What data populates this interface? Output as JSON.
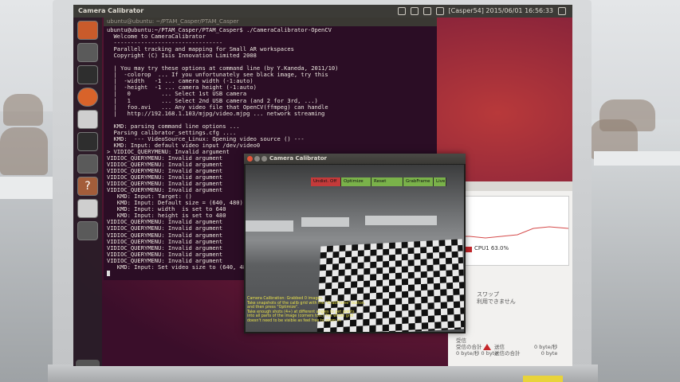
{
  "topbar": {
    "app_title": "Camera Calibrator",
    "status": "[Casper54] 2015/06/01 16:56:33"
  },
  "terminal": {
    "title": "ubuntu@ubuntu: ~/PTAM_Casper/PTAM_Casper",
    "lines": [
      "ubuntu@ubuntu:~/PTAM_Casper/PTAM_Casper$ ./CameraCalibrator-OpenCV",
      "  Welcome to CameraCalibrator",
      "  --------------------------------",
      "  Parallel tracking and mapping for Small AR workspaces",
      "  Copyright (C) Isis Innovation Limited 2008",
      "",
      "  | You may try these options at command line (by Y.Kaneda, 2011/10)",
      "  |  -colorop  ... If you unfortunately see black image, try this",
      "  |  -width   -1 ... camera width (-1:auto)",
      "  |  -height  -1 ... camera height (-1:auto)",
      "  |   0         ... Select 1st USB camera",
      "  |   1         ... Select 2nd USB camera (and 2 for 3rd, ...)",
      "  |   foo.avi   ... Any video file that OpenCV(ffmpeg) can handle",
      "  |   http://192.168.1.103/mjpg/video.mjpg ... network streaming",
      "",
      "  KMD: parsing command line options ...",
      "  Parsing calibrator_settings.cfg ....",
      "  KMD:  --- VideoSource_Linux: Opening video source () ---",
      "  KMD: Input: default video input /dev/video0",
      "> VIDIOC_QUERYMENU: Invalid argument",
      "VIDIOC_QUERYMENU: Invalid argument",
      "VIDIOC_QUERYMENU: Invalid argument",
      "VIDIOC_QUERYMENU: Invalid argument",
      "VIDIOC_QUERYMENU: Invalid argument",
      "VIDIOC_QUERYMENU: Invalid argument",
      "VIDIOC_QUERYMENU: Invalid argument",
      "   KMD: Input: Target: ()",
      "   KMD: Input: Default size = (640, 480)",
      "   KMD: Input: width  is set to 640",
      "   KMD: Input: height is set to 480",
      "VIDIOC_QUERYMENU: Invalid argument",
      "VIDIOC_QUERYMENU: Invalid argument",
      "VIDIOC_QUERYMENU: Invalid argument",
      "VIDIOC_QUERYMENU: Invalid argument",
      "VIDIOC_QUERYMENU: Invalid argument",
      "VIDIOC_QUERYMENU: Invalid argument",
      "VIDIOC_QUERYMENU: Invalid argument",
      "   KMD: Input: Set video size to (640, 480)."
    ]
  },
  "calibrator": {
    "title": "Camera Calibrator",
    "buttons": [
      {
        "label": "Undist. Off",
        "color": "#c43a3a"
      },
      {
        "label": "Optimize",
        "color": "#7ab24a"
      },
      {
        "label": "Reset",
        "color": "#7ab24a"
      },
      {
        "label": "GrabFrame",
        "color": "#7ab24a"
      },
      {
        "label": "Live",
        "color": "#7ab24a"
      }
    ],
    "message_lines": [
      "Camera Calibration: Grabbed 0 images.",
      "Take snapshots of the calib grid with the \"GrabFrame\" button,",
      "and then press \"Optimize\".",
      "Take enough shots (4+) at different angles to get points",
      "into all parts of the image (corners too.) The whole grid",
      "doesn't need to be visible as feel free to zoom in."
    ]
  },
  "sysmon": {
    "cpu_label": "CPU1 63.0%",
    "swap_title": "スワップ",
    "swap_status": "利用できません",
    "recv_label": "受信",
    "recv_total_label": "受信の合計",
    "recv_rate": "0 byte/秒",
    "recv_total": "0 byte",
    "send_label": "送信",
    "send_total_label": "送信の合計",
    "send_rate": "0 byte/秒",
    "send_total": "0 byte"
  },
  "colors": {
    "terminal_bg": "#2b0d25",
    "accent_red": "#c5262a",
    "message_yellow": "#e8e04a"
  }
}
